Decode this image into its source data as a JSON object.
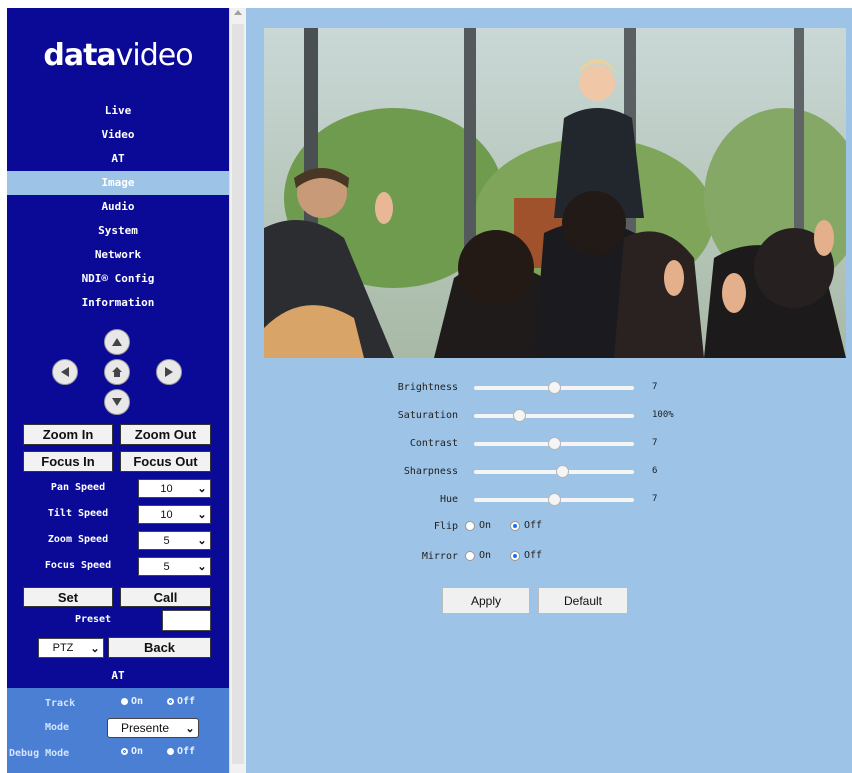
{
  "brand": {
    "logo_bold": "data",
    "logo_light": "video"
  },
  "nav": [
    {
      "label": "Live"
    },
    {
      "label": "Video"
    },
    {
      "label": "AT"
    },
    {
      "label": "Image",
      "active": true
    },
    {
      "label": "Audio"
    },
    {
      "label": "System"
    },
    {
      "label": "Network"
    },
    {
      "label": "NDI® Config"
    },
    {
      "label": "Information"
    }
  ],
  "ptz": {
    "zoom_in": "Zoom In",
    "zoom_out": "Zoom Out",
    "focus_in": "Focus In",
    "focus_out": "Focus Out",
    "pan_speed_label": "Pan Speed",
    "pan_speed": "10",
    "tilt_speed_label": "Tilt Speed",
    "tilt_speed": "10",
    "zoom_speed_label": "Zoom Speed",
    "zoom_speed": "5",
    "focus_speed_label": "Focus Speed",
    "focus_speed": "5",
    "set": "Set",
    "call": "Call",
    "preset_label": "Preset",
    "preset_value": "",
    "mode_select": "PTZ",
    "back": "Back"
  },
  "at": {
    "title": "AT",
    "track_label": "Track",
    "track_on": "On",
    "track_off": "Off",
    "track_value": "Off",
    "mode_label": "Mode",
    "mode_value": "Presente",
    "debug_label": "Debug Mode",
    "debug_on": "On",
    "debug_off": "Off",
    "debug_value": "On"
  },
  "image_settings": {
    "brightness": {
      "label": "Brightness",
      "value": "7",
      "level": 0.5
    },
    "saturation": {
      "label": "Saturation",
      "value": "100%",
      "level": 0.28
    },
    "contrast": {
      "label": "Contrast",
      "value": "7",
      "level": 0.5
    },
    "sharpness": {
      "label": "Sharpness",
      "value": "6",
      "level": 0.55
    },
    "hue": {
      "label": "Hue",
      "value": "7",
      "level": 0.5
    },
    "flip": {
      "label": "Flip",
      "on": "On",
      "off": "Off",
      "value": "Off"
    },
    "mirror": {
      "label": "Mirror",
      "on": "On",
      "off": "Off",
      "value": "Off"
    }
  },
  "actions": {
    "apply": "Apply",
    "default": "Default"
  },
  "colors": {
    "sidebar": "#0a0a96",
    "active_nav": "#9dc3e6",
    "main_bg": "#9dc3e6",
    "at_panel": "#4a7fd4",
    "radio_on": "#1a73e8"
  }
}
